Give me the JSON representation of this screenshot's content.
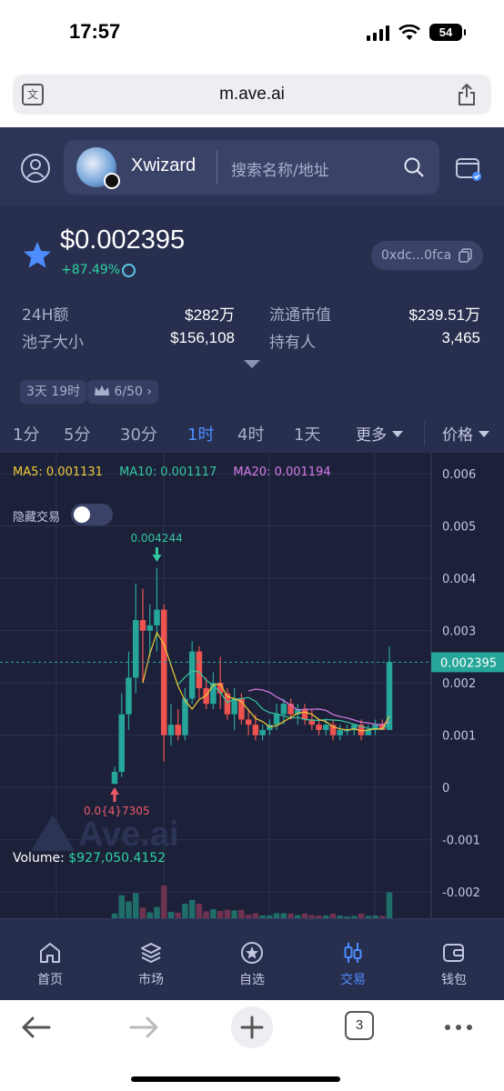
{
  "status_bar": {
    "time": "17:57",
    "battery": "54"
  },
  "browser": {
    "url": "m.ave.ai",
    "tab_count": "3"
  },
  "header": {
    "token_name": "Xwizard",
    "search_placeholder": "搜索名称/地址"
  },
  "token": {
    "price": "$0.002395",
    "change": "+87.49%",
    "address": "0xdc...0fca",
    "stats": {
      "vol_24h_label": "24H额",
      "vol_24h_value": "$282万",
      "market_cap_label": "流通市值",
      "market_cap_value": "$239.51万",
      "pool_label": "池子大小",
      "pool_value": "$156,108",
      "holders_label": "持有人",
      "holders_value": "3,465"
    },
    "chips": {
      "age": "3天 19时",
      "rank": "6/50"
    }
  },
  "timeframes": {
    "tabs": [
      "1分",
      "5分",
      "30分",
      "1时",
      "4时",
      "1天"
    ],
    "active": "1时",
    "more_label": "更多",
    "price_label": "价格"
  },
  "chart_legend": {
    "ma5": "MA5: 0.001131",
    "ma10": "MA10: 0.001117",
    "ma20": "MA20: 0.001194",
    "hide_trades": "隐藏交易",
    "hide_trades_on": false,
    "volume_label": "Volume: ",
    "volume_value": "$927,050.4152",
    "watermark": "Ave.ai"
  },
  "colors": {
    "up": "#26a69a",
    "down": "#ef5350",
    "accent": "#4d8dff",
    "ma5": "#f0c93a",
    "ma10": "#35c7a0",
    "ma20": "#d77be8"
  },
  "chart_data": {
    "type": "candlestick",
    "y_ticks": [
      "0.006",
      "0.005",
      "0.004",
      "0.003",
      "0.002",
      "0.001",
      "0",
      "-0.001",
      "-0.002"
    ],
    "ylim": [
      -0.0025,
      0.0064
    ],
    "current_price_label": "0.002395",
    "current_price": 0.002395,
    "high_annotation": "0.004244",
    "high_value": 0.004244,
    "low_annotation": "0.0{4}7305",
    "low_value": 7.305e-05,
    "candles": [
      {
        "o": 7e-05,
        "h": 0.0004,
        "l": 7e-05,
        "c": 0.0003
      },
      {
        "o": 0.0003,
        "h": 0.0018,
        "l": 0.0002,
        "c": 0.0014
      },
      {
        "o": 0.0014,
        "h": 0.0026,
        "l": 0.0011,
        "c": 0.0021
      },
      {
        "o": 0.0021,
        "h": 0.0039,
        "l": 0.0018,
        "c": 0.0032
      },
      {
        "o": 0.0032,
        "h": 0.0038,
        "l": 0.002,
        "c": 0.003
      },
      {
        "o": 0.003,
        "h": 0.0035,
        "l": 0.0025,
        "c": 0.0031
      },
      {
        "o": 0.0031,
        "h": 0.0042,
        "l": 0.0026,
        "c": 0.0034
      },
      {
        "o": 0.0034,
        "h": 0.0035,
        "l": 0.0005,
        "c": 0.001
      },
      {
        "o": 0.001,
        "h": 0.0016,
        "l": 0.0008,
        "c": 0.0012
      },
      {
        "o": 0.0012,
        "h": 0.0015,
        "l": 0.0009,
        "c": 0.001
      },
      {
        "o": 0.001,
        "h": 0.0019,
        "l": 0.0009,
        "c": 0.0017
      },
      {
        "o": 0.0017,
        "h": 0.0028,
        "l": 0.0016,
        "c": 0.0026
      },
      {
        "o": 0.0026,
        "h": 0.0027,
        "l": 0.0017,
        "c": 0.0019
      },
      {
        "o": 0.0019,
        "h": 0.0021,
        "l": 0.0015,
        "c": 0.0016
      },
      {
        "o": 0.0016,
        "h": 0.0022,
        "l": 0.0015,
        "c": 0.002
      },
      {
        "o": 0.002,
        "h": 0.0025,
        "l": 0.0015,
        "c": 0.0018
      },
      {
        "o": 0.0018,
        "h": 0.0019,
        "l": 0.0013,
        "c": 0.0014
      },
      {
        "o": 0.0014,
        "h": 0.0019,
        "l": 0.0011,
        "c": 0.0017
      },
      {
        "o": 0.0017,
        "h": 0.0018,
        "l": 0.0012,
        "c": 0.0013
      },
      {
        "o": 0.0013,
        "h": 0.0015,
        "l": 0.001,
        "c": 0.0012
      },
      {
        "o": 0.0012,
        "h": 0.0014,
        "l": 0.0009,
        "c": 0.001
      },
      {
        "o": 0.001,
        "h": 0.0012,
        "l": 0.0009,
        "c": 0.0011
      },
      {
        "o": 0.0011,
        "h": 0.0013,
        "l": 0.001,
        "c": 0.0012
      },
      {
        "o": 0.0012,
        "h": 0.0016,
        "l": 0.0011,
        "c": 0.0014
      },
      {
        "o": 0.0014,
        "h": 0.0017,
        "l": 0.0012,
        "c": 0.0016
      },
      {
        "o": 0.0016,
        "h": 0.0017,
        "l": 0.0013,
        "c": 0.0014
      },
      {
        "o": 0.0014,
        "h": 0.0016,
        "l": 0.0012,
        "c": 0.0015
      },
      {
        "o": 0.0015,
        "h": 0.0016,
        "l": 0.0012,
        "c": 0.0013
      },
      {
        "o": 0.0013,
        "h": 0.0015,
        "l": 0.0011,
        "c": 0.0012
      },
      {
        "o": 0.0012,
        "h": 0.0013,
        "l": 0.001,
        "c": 0.0011
      },
      {
        "o": 0.0011,
        "h": 0.0013,
        "l": 0.001,
        "c": 0.0012
      },
      {
        "o": 0.0012,
        "h": 0.0013,
        "l": 0.0009,
        "c": 0.001
      },
      {
        "o": 0.001,
        "h": 0.0012,
        "l": 0.0009,
        "c": 0.0011
      },
      {
        "o": 0.0011,
        "h": 0.0012,
        "l": 0.001,
        "c": 0.0011
      },
      {
        "o": 0.0011,
        "h": 0.0012,
        "l": 0.001,
        "c": 0.0012
      },
      {
        "o": 0.0012,
        "h": 0.0013,
        "l": 0.0009,
        "c": 0.001
      },
      {
        "o": 0.001,
        "h": 0.0012,
        "l": 0.001,
        "c": 0.0011
      },
      {
        "o": 0.0011,
        "h": 0.0013,
        "l": 0.001,
        "c": 0.0012
      },
      {
        "o": 0.0012,
        "h": 0.0013,
        "l": 0.0011,
        "c": 0.0011
      },
      {
        "o": 0.0011,
        "h": 0.0027,
        "l": 0.0011,
        "c": 0.0024
      }
    ]
  },
  "bottom_nav": {
    "items": [
      "首页",
      "市场",
      "自选",
      "交易",
      "钱包"
    ],
    "active": "交易"
  }
}
